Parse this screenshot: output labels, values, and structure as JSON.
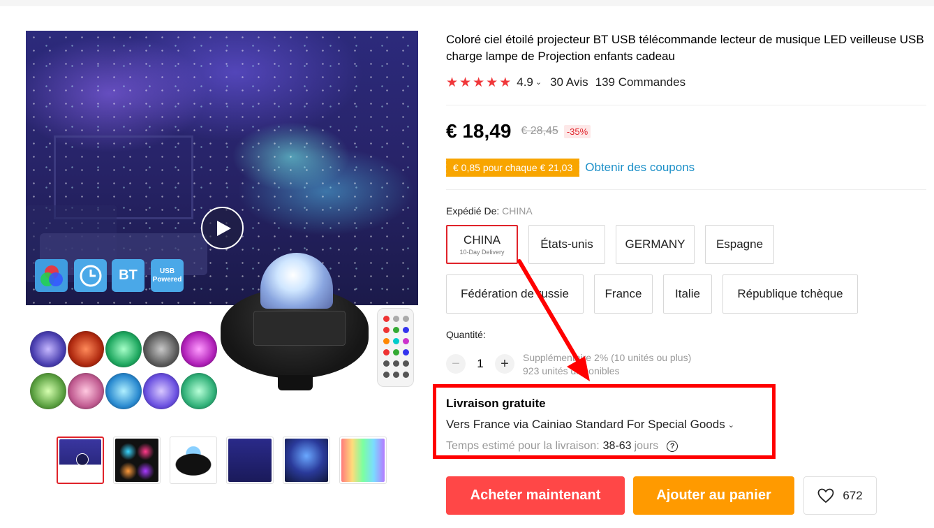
{
  "product": {
    "title": "Coloré ciel étoilé projecteur BT USB télécommande lecteur de musique LED veilleuse USB charge lampe de Projection enfants cadeau",
    "rating_value": "4.9",
    "reviews": "30 Avis",
    "orders": "139 Commandes"
  },
  "gallery": {
    "feature_icons": {
      "bt": "BT",
      "usb": "USB Powered"
    },
    "thumbnails_count": 6,
    "active_thumbnail": 1
  },
  "price": {
    "current": "€ 18,49",
    "original": "€ 28,45",
    "discount": "-35%"
  },
  "coupon": {
    "badge": "€ 0,85 pour chaque € 21,03",
    "link": "Obtenir des coupons"
  },
  "shipping_from": {
    "label": "Expédié De:",
    "value": "CHINA",
    "options": [
      {
        "label": "CHINA",
        "sub": "10-Day Delivery",
        "selected": true
      },
      {
        "label": "États-unis"
      },
      {
        "label": "GERMANY"
      },
      {
        "label": "Espagne"
      },
      {
        "label": "Fédération de russie"
      },
      {
        "label": "France"
      },
      {
        "label": "Italie"
      },
      {
        "label": "République tchèque"
      }
    ]
  },
  "quantity": {
    "label": "Quantité:",
    "value": "1",
    "info_line1": "Supplémentaire 2% (10 unités ou plus)",
    "info_line2": "923 unités disponibles"
  },
  "delivery": {
    "title": "Livraison gratuite",
    "method": "Vers France via Cainiao Standard For Special Goods",
    "time_label": "Temps estimé pour la livraison:",
    "time_days": "38-63",
    "time_unit": "jours"
  },
  "actions": {
    "buy": "Acheter maintenant",
    "cart": "Ajouter au panier",
    "wishlist_count": "672"
  },
  "colors": {
    "star": "#f0373a",
    "buy_button": "#ff4747",
    "cart_button": "#ff9a00",
    "coupon_badge": "#f8a500",
    "link": "#1d90c8",
    "highlight": "#ff0000"
  }
}
